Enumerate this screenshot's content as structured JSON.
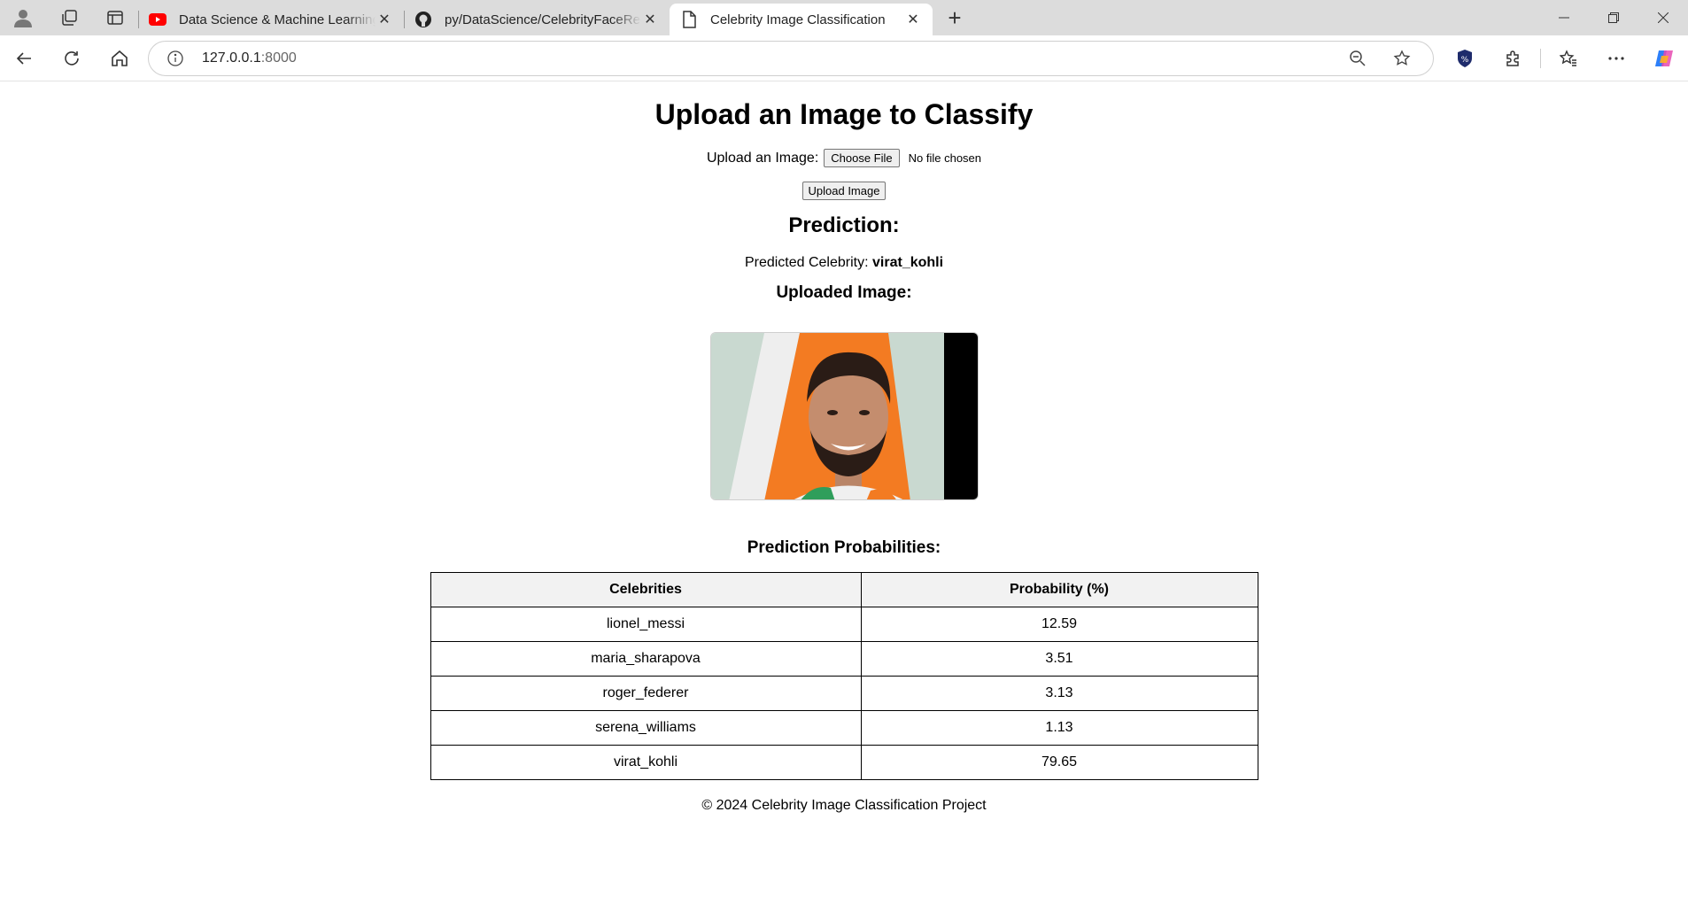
{
  "browser": {
    "tabs": [
      {
        "title": "Data Science & Machine Learning",
        "favicon": "youtube-icon"
      },
      {
        "title": "py/DataScience/CelebrityFaceRec",
        "favicon": "github-icon"
      },
      {
        "title": "Celebrity Image Classification",
        "favicon": "page-icon",
        "active": true
      }
    ],
    "url_host": "127.0.0.1",
    "url_port": ":8000"
  },
  "page": {
    "heading": "Upload an Image to Classify",
    "upload_label": "Upload an Image:",
    "choose_file_label": "Choose File",
    "no_file_text": "No file chosen",
    "upload_button": "Upload Image",
    "prediction_heading": "Prediction:",
    "predicted_prefix": "Predicted Celebrity:",
    "predicted_name": "virat_kohli",
    "uploaded_heading": "Uploaded Image:",
    "probabilities_heading": "Prediction Probabilities:",
    "table": {
      "headers": [
        "Celebrities",
        "Probability (%)"
      ],
      "rows": [
        [
          "lionel_messi",
          "12.59"
        ],
        [
          "maria_sharapova",
          "3.51"
        ],
        [
          "roger_federer",
          "3.13"
        ],
        [
          "serena_williams",
          "1.13"
        ],
        [
          "virat_kohli",
          "79.65"
        ]
      ]
    },
    "footer": "© 2024 Celebrity Image Classification Project"
  },
  "colors": {
    "tabstrip": "#dcdcdc",
    "table_header_bg": "#f2f2f2",
    "flag_orange": "#f37b22",
    "photo_bg": "#c9d9d0"
  }
}
